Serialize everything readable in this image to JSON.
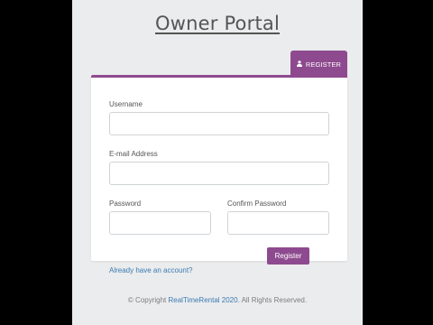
{
  "header": {
    "title": "Owner Portal"
  },
  "tab": {
    "label": "REGISTER",
    "icon": "user-icon"
  },
  "form": {
    "username_label": "Username",
    "username_value": "",
    "email_label": "E-mail Address",
    "email_value": "",
    "password_label": "Password",
    "password_value": "",
    "confirm_label": "Confirm Password",
    "confirm_value": "",
    "submit_label": "Register",
    "login_link": "Already have an account?"
  },
  "footer": {
    "prefix": "© Copyright ",
    "brand": "RealTimeRental 2020.",
    "suffix": " All Rights Reserved."
  },
  "colors": {
    "accent": "#8e4a8f",
    "link": "#3a7ab3",
    "background": "#ebeced"
  }
}
